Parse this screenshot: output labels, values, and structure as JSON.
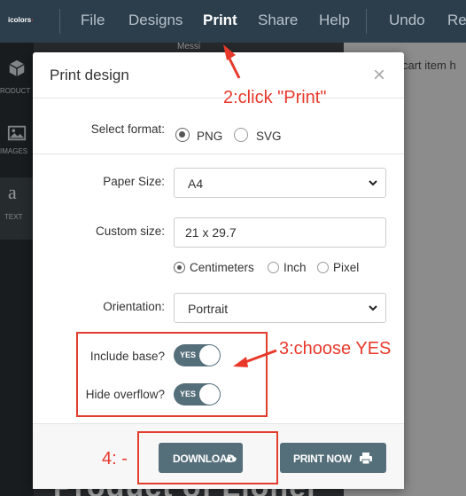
{
  "topbar": {
    "logo": "icolors",
    "menu": [
      {
        "id": "file",
        "label": "File"
      },
      {
        "id": "designs",
        "label": "Designs"
      },
      {
        "id": "print",
        "label": "Print"
      },
      {
        "id": "share",
        "label": "Share"
      },
      {
        "id": "help",
        "label": "Help"
      },
      {
        "id": "undo",
        "label": "Undo"
      },
      {
        "id": "redo",
        "label": "Re"
      }
    ]
  },
  "sidebar": {
    "items": [
      {
        "icon": "cube-icon",
        "label": "RODUCT"
      },
      {
        "icon": "image-icon",
        "label": "IMAGES"
      },
      {
        "icon": "text-icon",
        "label": "TEXT"
      }
    ]
  },
  "background": {
    "messi": "Messi",
    "cart": "cart item h",
    "bottom_text": "Product of Lionel"
  },
  "modal": {
    "title": "Print design",
    "close": "×",
    "format": {
      "label": "Select format:",
      "options": [
        {
          "label": "PNG",
          "checked": true
        },
        {
          "label": "SVG",
          "checked": false
        }
      ]
    },
    "paper_size": {
      "label": "Paper Size:",
      "value": "A4"
    },
    "custom_size": {
      "label": "Custom size:",
      "value": "21 x 29.7"
    },
    "units": [
      {
        "label": "Centimeters",
        "checked": true
      },
      {
        "label": "Inch",
        "checked": false
      },
      {
        "label": "Pixel",
        "checked": false
      }
    ],
    "orientation": {
      "label": "Orientation:",
      "value": "Portrait"
    },
    "include_base": {
      "label": "Include base?",
      "state": "YES"
    },
    "hide_overflow": {
      "label": "Hide overflow?",
      "state": "YES"
    },
    "download_label": "DOWNLOAD",
    "print_now_label": "PRINT NOW"
  },
  "annotations": {
    "step2": "2:click \"Print\"",
    "step3": "3:choose YES",
    "step4": "4: -",
    "color": "#e8392b"
  }
}
